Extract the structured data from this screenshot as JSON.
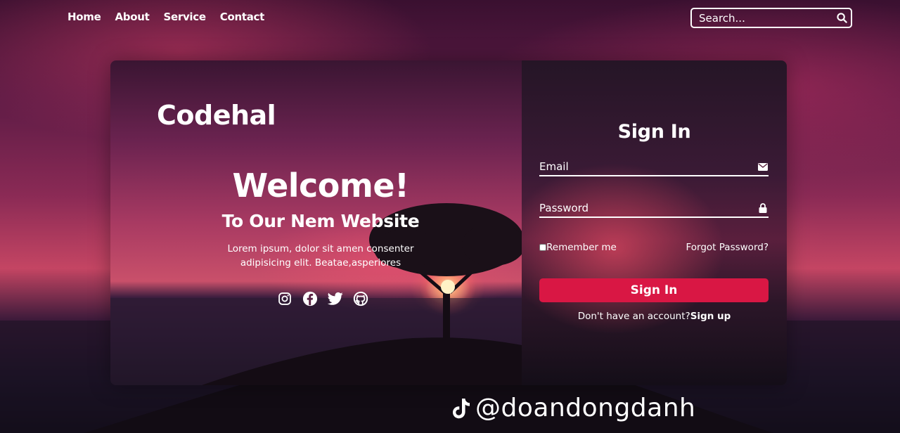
{
  "nav": {
    "items": [
      "Home",
      "About",
      "Service",
      "Contact"
    ]
  },
  "search": {
    "placeholder": "Search..."
  },
  "brand": "Codehal",
  "welcome": {
    "heading": "Welcome!",
    "subheading": "To Our Nem Website",
    "text_line1": "Lorem ipsum, dolor sit amen consenter",
    "text_line2": "adipisicing elit. Beatae,asperiores"
  },
  "socials": [
    "instagram-icon",
    "facebook-icon",
    "twitter-icon",
    "github-icon"
  ],
  "form": {
    "title": "Sign In",
    "email_placeholder": "Email",
    "password_placeholder": "Password",
    "remember_label": "Remember me",
    "forgot_label": "Forgot Password?",
    "submit_label": "Sign In",
    "signup_prompt": "Don't have an account?",
    "signup_link": "Sign up"
  },
  "watermark": "@doandongdanh",
  "colors": {
    "accent": "#d91744",
    "text": "#ffffff"
  }
}
